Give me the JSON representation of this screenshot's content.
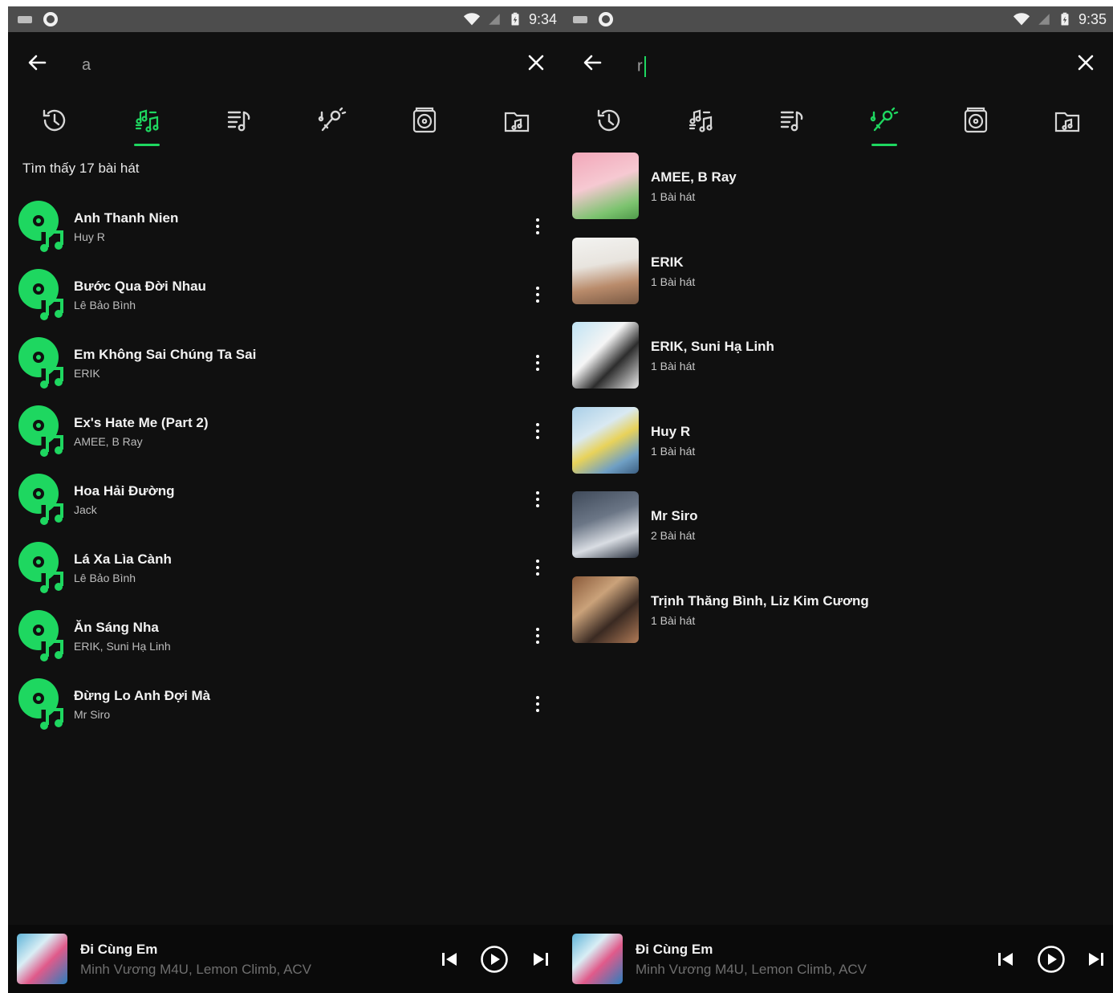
{
  "left": {
    "status": {
      "time": "9:34"
    },
    "search": {
      "query": "a"
    },
    "tabs": [
      {
        "icon": "history-icon",
        "active": false
      },
      {
        "icon": "songs-icon",
        "active": true
      },
      {
        "icon": "playlist-icon",
        "active": false
      },
      {
        "icon": "artist-icon",
        "active": false
      },
      {
        "icon": "album-icon",
        "active": false
      },
      {
        "icon": "folder-icon",
        "active": false
      }
    ],
    "result_count": "Tìm thấy 17 bài hát",
    "songs": [
      {
        "title": "Anh Thanh Nien",
        "artist": "Huy R"
      },
      {
        "title": "Bước Qua Đời Nhau",
        "artist": "Lê Bảo Bình"
      },
      {
        "title": "Em Không Sai Chúng Ta Sai",
        "artist": "ERIK"
      },
      {
        "title": "Ex's Hate Me (Part 2)",
        "artist": "AMEE, B Ray"
      },
      {
        "title": "Hoa Hải Đường",
        "artist": "Jack"
      },
      {
        "title": "Lá Xa Lìa Cành",
        "artist": "Lê Bảo Bình"
      },
      {
        "title": "Ăn Sáng Nha",
        "artist": "ERIK, Suni Hạ Linh"
      },
      {
        "title": "Đừng Lo Anh Đợi Mà",
        "artist": "Mr Siro"
      }
    ],
    "player": {
      "title": "Đi Cùng Em",
      "artist": "Minh Vương M4U, Lemon Climb, ACV"
    }
  },
  "right": {
    "status": {
      "time": "9:35"
    },
    "search": {
      "query": "r"
    },
    "tabs": [
      {
        "icon": "history-icon",
        "active": false
      },
      {
        "icon": "songs-icon",
        "active": false
      },
      {
        "icon": "playlist-icon",
        "active": false
      },
      {
        "icon": "artist-icon",
        "active": true
      },
      {
        "icon": "album-icon",
        "active": false
      },
      {
        "icon": "folder-icon",
        "active": false
      }
    ],
    "artists": [
      {
        "name": "AMEE, B Ray",
        "count": "1 Bài hát"
      },
      {
        "name": "ERIK",
        "count": "1 Bài hát"
      },
      {
        "name": "ERIK, Suni Hạ Linh",
        "count": "1 Bài hát"
      },
      {
        "name": "Huy R",
        "count": "1 Bài hát"
      },
      {
        "name": "Mr Siro",
        "count": "2 Bài hát"
      },
      {
        "name": "Trịnh Thăng Bình, Liz Kim Cương",
        "count": "1 Bài hát"
      }
    ],
    "player": {
      "title": "Đi Cùng Em",
      "artist": "Minh Vương M4U, Lemon Climb, ACV"
    }
  },
  "colors": {
    "accent": "#1ed760",
    "background": "#101010",
    "icon": "#d6d6d6"
  }
}
